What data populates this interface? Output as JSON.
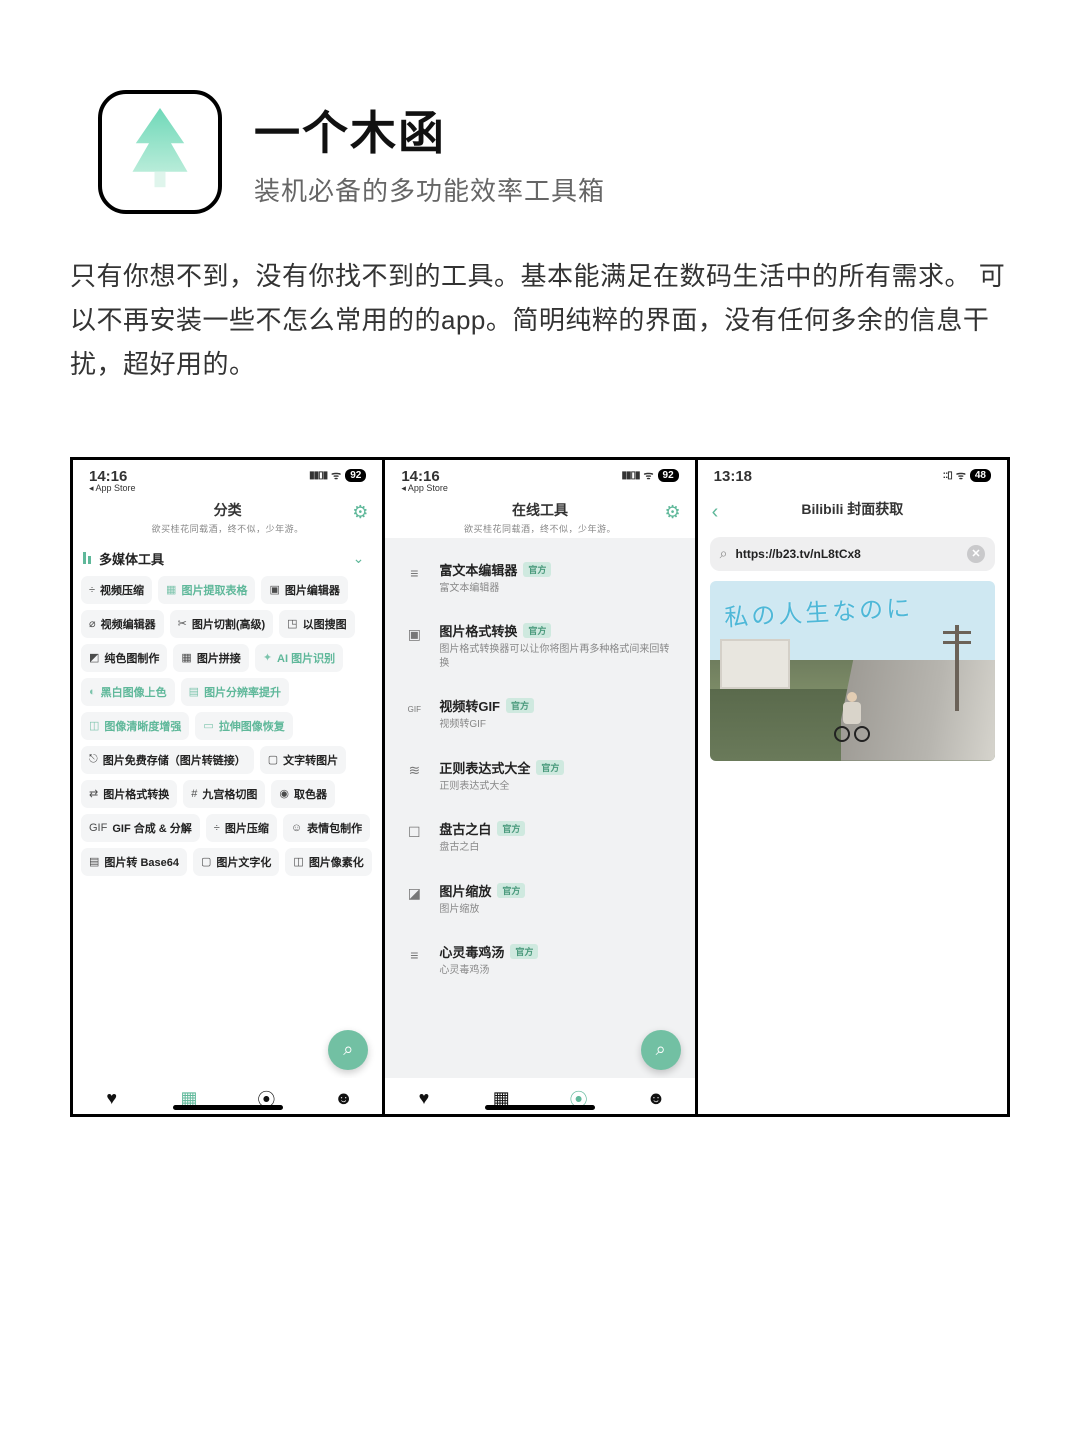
{
  "hero": {
    "app_name": "一个木函",
    "tagline": "装机必备的多功能效率工具箱"
  },
  "description": "只有你想不到，没有你找不到的工具。基本能满足在数码生活中的所有需求。 可以不再安装一些不怎么常用的的app。简明纯粹的界面，没有任何多余的信息干扰，超好用的。",
  "screen1": {
    "status": {
      "time": "14:16",
      "back_app": "◂ App Store",
      "battery": "92"
    },
    "title": "分类",
    "subtitle": "欲买桂花同载酒，终不似，少年游。",
    "section": "多媒体工具",
    "chips": [
      {
        "icon": "÷",
        "label": "视频压缩",
        "accent": false
      },
      {
        "icon": "▦",
        "label": "图片提取表格",
        "accent": true
      },
      {
        "icon": "▣",
        "label": "图片编辑器",
        "accent": false
      },
      {
        "icon": "⌀",
        "label": "视频编辑器",
        "accent": false
      },
      {
        "icon": "✂",
        "label": "图片切割(高级)",
        "accent": false
      },
      {
        "icon": "◳",
        "label": "以图搜图",
        "accent": false
      },
      {
        "icon": "◩",
        "label": "纯色图制作",
        "accent": false
      },
      {
        "icon": "▦",
        "label": "图片拼接",
        "accent": false
      },
      {
        "icon": "✦",
        "label": "AI 图片识别",
        "accent": true
      },
      {
        "icon": "◐",
        "label": "黑白图像上色",
        "accent": true
      },
      {
        "icon": "▤",
        "label": "图片分辨率提升",
        "accent": true
      },
      {
        "icon": "◫",
        "label": "图像清晰度增强",
        "accent": true
      },
      {
        "icon": "▭",
        "label": "拉伸图像恢复",
        "accent": true
      },
      {
        "icon": "⎋",
        "label": "图片免费存储（图片转链接）",
        "accent": false
      },
      {
        "icon": "▢",
        "label": "文字转图片",
        "accent": false
      },
      {
        "icon": "⇄",
        "label": "图片格式转换",
        "accent": false
      },
      {
        "icon": "#",
        "label": "九宫格切图",
        "accent": false
      },
      {
        "icon": "◉",
        "label": "取色器",
        "accent": false
      },
      {
        "icon": "GIF",
        "label": "GIF 合成 & 分解",
        "accent": false
      },
      {
        "icon": "÷",
        "label": "图片压缩",
        "accent": false
      },
      {
        "icon": "☺",
        "label": "表情包制作",
        "accent": false
      },
      {
        "icon": "▤",
        "label": "图片转 Base64",
        "accent": false
      },
      {
        "icon": "▢",
        "label": "图片文字化",
        "accent": false
      },
      {
        "icon": "◫",
        "label": "图片像素化",
        "accent": false
      }
    ]
  },
  "screen2": {
    "status": {
      "time": "14:16",
      "back_app": "◂ App Store",
      "battery": "92"
    },
    "title": "在线工具",
    "subtitle": "欲买桂花同载酒，终不似，少年游。",
    "badge": "官方",
    "rows": [
      {
        "icon": "≡",
        "title": "富文本编辑器",
        "desc": "富文本编辑器"
      },
      {
        "icon": "▣",
        "title": "图片格式转换",
        "desc": "图片格式转换器可以让你将图片再多种格式间来回转换"
      },
      {
        "icon": "GIF",
        "title": "视频转GIF",
        "desc": "视频转GIF"
      },
      {
        "icon": "≋",
        "title": "正则表达式大全",
        "desc": "正则表达式大全"
      },
      {
        "icon": "☐",
        "title": "盘古之白",
        "desc": "盘古之白"
      },
      {
        "icon": "◪",
        "title": "图片缩放",
        "desc": "图片缩放"
      },
      {
        "icon": "≡",
        "title": "心灵毒鸡汤",
        "desc": "心灵毒鸡汤"
      }
    ]
  },
  "screen3": {
    "status": {
      "time": "13:18",
      "battery": "48"
    },
    "title": "Bilibili 封面获取",
    "search_value": "https://b23.tv/nL8tCx8",
    "cover_script": "私の人生なのに"
  }
}
